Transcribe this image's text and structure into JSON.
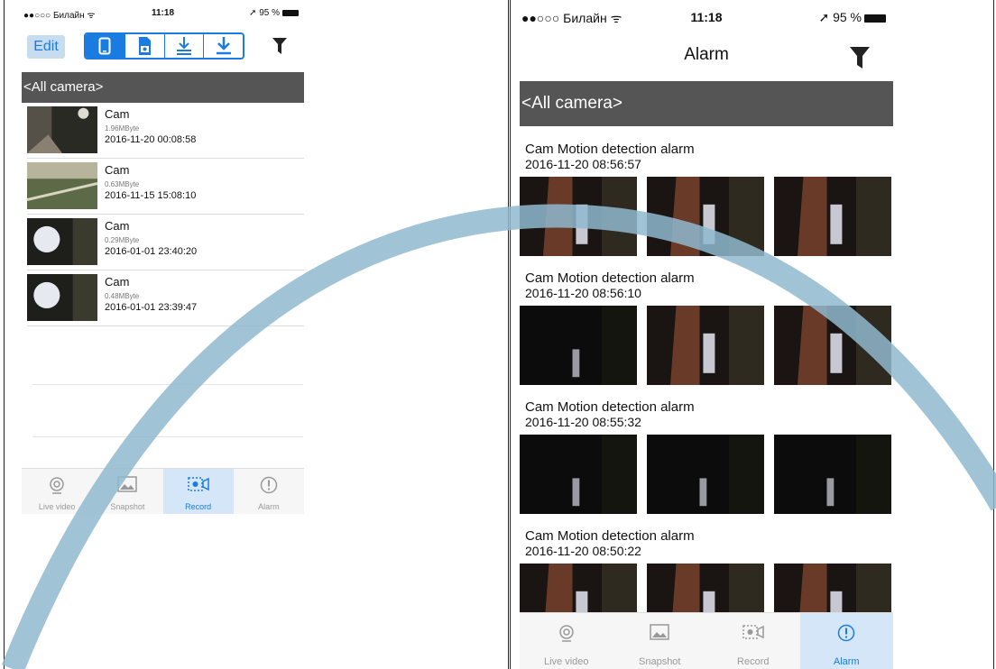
{
  "left": {
    "status": {
      "carrier": "●●○○○ Билайн ᯤ",
      "time": "11:18",
      "battery": "➚ 95 %"
    },
    "toolbar": {
      "edit_label": "Edit"
    },
    "camera_filter": "<All camera>",
    "records": [
      {
        "name": "Cam",
        "size": "1.96MByte",
        "date": "2016-11-20 00:08:58",
        "thumb": "dark-room"
      },
      {
        "name": "Cam",
        "size": "0.63MByte",
        "date": "2016-11-15 15:08:10",
        "thumb": "outdoor"
      },
      {
        "name": "Cam",
        "size": "0.29MByte",
        "date": "2016-01-01 23:40:20",
        "thumb": "light-glare"
      },
      {
        "name": "Cam",
        "size": "0.48MByte",
        "date": "2016-01-01 23:39:47",
        "thumb": "light-glare"
      }
    ],
    "tabs": [
      {
        "label": "Live video",
        "icon": "live-video-icon",
        "active": false
      },
      {
        "label": "Snapshot",
        "icon": "snapshot-icon",
        "active": false
      },
      {
        "label": "Record",
        "icon": "record-icon",
        "active": true
      },
      {
        "label": "Alarm",
        "icon": "alarm-icon",
        "active": false
      }
    ]
  },
  "right": {
    "status": {
      "carrier": "●●○○○ Билайн ᯤ",
      "time": "11:18",
      "battery": "➚ 95 %"
    },
    "title": "Alarm",
    "camera_filter": "<All camera>",
    "alarms": [
      {
        "title": "Cam Motion detection alarm",
        "date": "2016-11-20 08:56:57"
      },
      {
        "title": "Cam Motion detection alarm",
        "date": "2016-11-20 08:56:10"
      },
      {
        "title": "Cam Motion detection alarm",
        "date": "2016-11-20 08:55:32"
      },
      {
        "title": "Cam Motion detection alarm",
        "date": "2016-11-20 08:50:22"
      }
    ],
    "tabs": [
      {
        "label": "Live video",
        "icon": "live-video-icon",
        "active": false
      },
      {
        "label": "Snapshot",
        "icon": "snapshot-icon",
        "active": false
      },
      {
        "label": "Record",
        "icon": "record-icon",
        "active": false
      },
      {
        "label": "Alarm",
        "icon": "alarm-icon",
        "active": true
      }
    ]
  },
  "colors": {
    "accent": "#1a7ce0",
    "camera_bar": "#555555",
    "active_tab_bg": "#d4e6f8",
    "watermark_arc": "#8fb9cf"
  }
}
